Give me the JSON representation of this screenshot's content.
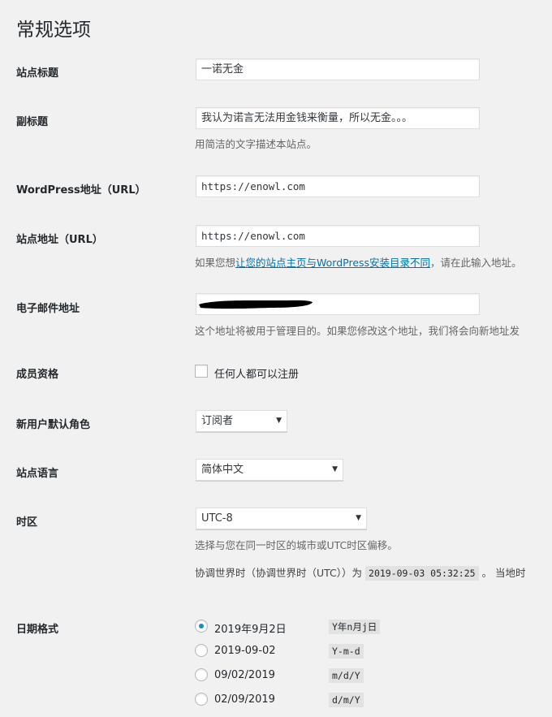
{
  "page": {
    "title": "常规选项"
  },
  "site_title": {
    "label": "站点标题",
    "value": "一诺无金"
  },
  "tagline": {
    "label": "副标题",
    "value": "我认为诺言无法用金钱来衡量，所以无金。。。",
    "description": "用简洁的文字描述本站点。"
  },
  "wp_address": {
    "label": "WordPress地址（URL）",
    "value": "https://enowl.com"
  },
  "site_address": {
    "label": "站点地址（URL）",
    "value": "https://enowl.com",
    "desc_prefix": "如果您想",
    "desc_link": "让您的站点主页与WordPress安装目录不同",
    "desc_suffix": "，请在此输入地址。"
  },
  "email": {
    "label": "电子邮件地址",
    "description": "这个地址将被用于管理目的。如果您修改这个地址，我们将会向新地址发"
  },
  "membership": {
    "label": "成员资格",
    "checkbox_label": "任何人都可以注册",
    "checked": false
  },
  "default_role": {
    "label": "新用户默认角色",
    "selected": "订阅者"
  },
  "site_language": {
    "label": "站点语言",
    "selected": "简体中文"
  },
  "timezone": {
    "label": "时区",
    "selected": "UTC-8",
    "description": "选择与您在同一时区的城市或UTC时区偏移。",
    "utc_prefix": "协调世界时（协调世界时（UTC））为",
    "utc_time": "2019-09-03 05:32:25",
    "utc_suffix": "。 当地时"
  },
  "date_format": {
    "label": "日期格式",
    "options": [
      {
        "label": "2019年9月2日",
        "code": "Y年n月j日",
        "checked": true
      },
      {
        "label": "2019-09-02",
        "code": "Y-m-d",
        "checked": false
      },
      {
        "label": "09/02/2019",
        "code": "m/d/Y",
        "checked": false
      },
      {
        "label": "02/09/2019",
        "code": "d/m/Y",
        "checked": false
      }
    ]
  },
  "icons": {
    "select_arrow": "triangle-down-icon"
  },
  "colors": {
    "link": "#0073aa",
    "radio_checked": "#1e8cbe",
    "background": "#f1f1f1"
  }
}
